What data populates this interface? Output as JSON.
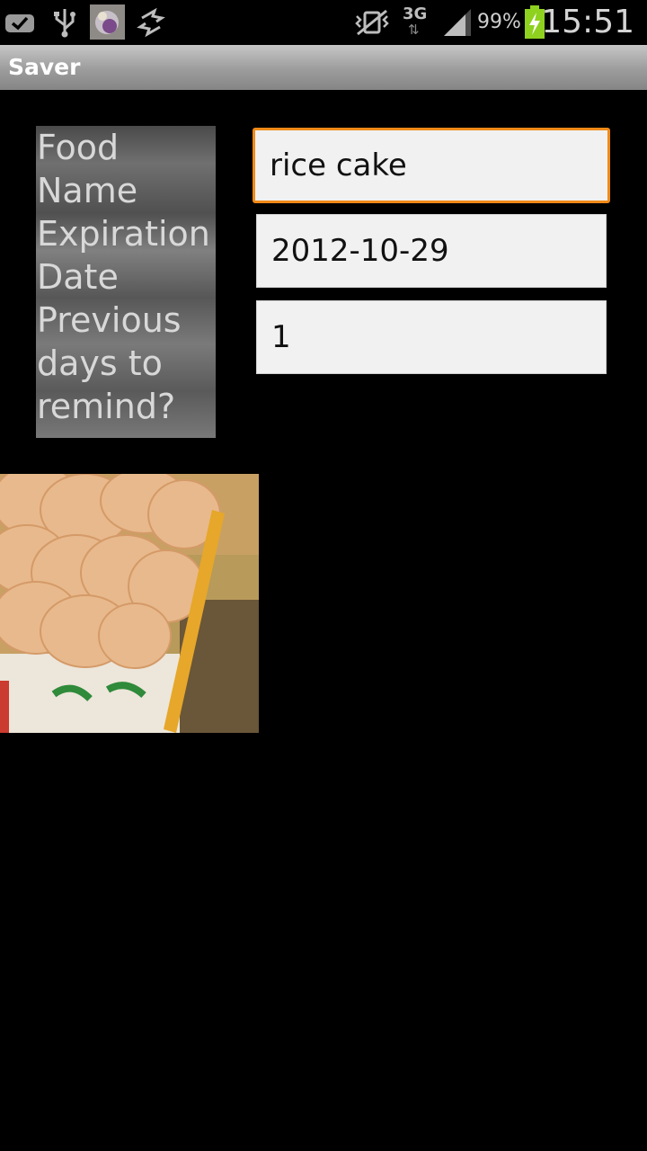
{
  "status_bar": {
    "icons": [
      "check-mail-icon",
      "usb-icon",
      "app-thumbnail-icon",
      "sync-icon",
      "vibrate-silent-icon",
      "network-3g-icon",
      "signal-strength-icon",
      "battery-charging-icon"
    ],
    "network_type": "3G",
    "battery_percent": "99%",
    "time": "15:51"
  },
  "app": {
    "title": "Saver"
  },
  "form": {
    "labels": [
      "Food Name",
      "Expiration Date",
      "Previous days to remind?"
    ],
    "food_name": {
      "value": "rice cake"
    },
    "expiration_date": {
      "value": "2012-10-29"
    },
    "remind_days": {
      "value": "1"
    }
  },
  "photo": {
    "subject": "cookie-package-photo"
  },
  "colors": {
    "focus_border": "#f08a18",
    "input_bg": "#f1f1f1",
    "background": "#000000",
    "battery": "#8fd11f"
  }
}
